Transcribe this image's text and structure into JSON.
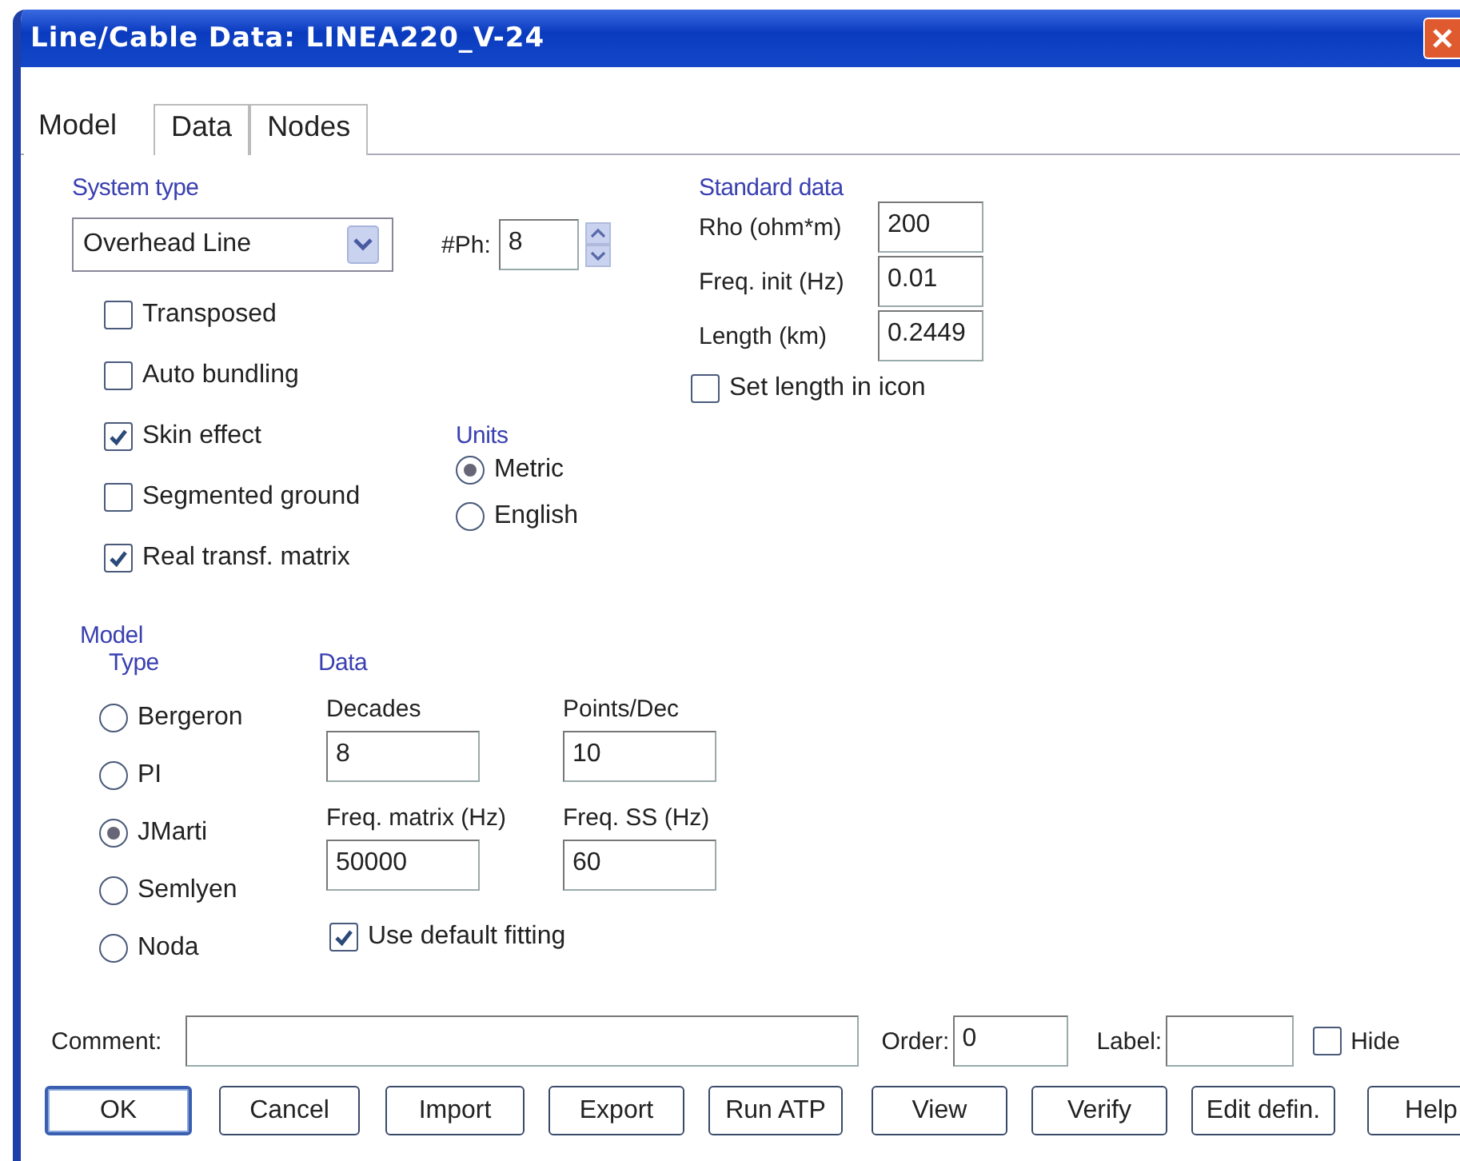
{
  "window": {
    "title": "Line/Cable Data: LINEA220_V-24"
  },
  "tabs": [
    {
      "label": "Model",
      "selected": true
    },
    {
      "label": "Data",
      "selected": false
    },
    {
      "label": "Nodes",
      "selected": false
    }
  ],
  "system_type": {
    "heading": "System type",
    "value": "Overhead Line",
    "phases_label": "#Ph:",
    "phases": "8"
  },
  "options": [
    {
      "label": "Transposed",
      "checked": false
    },
    {
      "label": "Auto bundling",
      "checked": false
    },
    {
      "label": "Skin effect",
      "checked": true
    },
    {
      "label": "Segmented ground",
      "checked": false
    },
    {
      "label": "Real transf. matrix",
      "checked": true
    }
  ],
  "units": {
    "heading": "Units",
    "options": [
      {
        "label": "Metric",
        "selected": true
      },
      {
        "label": "English",
        "selected": false
      }
    ]
  },
  "standard_data": {
    "heading": "Standard data",
    "fields": [
      {
        "label": "Rho (ohm*m)",
        "value": "200"
      },
      {
        "label": "Freq. init (Hz)",
        "value": "0.01"
      },
      {
        "label": "Length (km)",
        "value": "0.2449"
      }
    ],
    "set_length": {
      "label": "Set length in icon",
      "checked": false
    }
  },
  "model": {
    "heading": "Model",
    "type_heading": "Type",
    "types": [
      {
        "label": "Bergeron",
        "selected": false
      },
      {
        "label": "PI",
        "selected": false
      },
      {
        "label": "JMarti",
        "selected": true
      },
      {
        "label": "Semlyen",
        "selected": false
      },
      {
        "label": "Noda",
        "selected": false
      }
    ],
    "data_heading": "Data",
    "fields": [
      {
        "label": "Decades",
        "value": "8"
      },
      {
        "label": "Points/Dec",
        "value": "10"
      },
      {
        "label": "Freq. matrix (Hz)",
        "value": "50000"
      },
      {
        "label": "Freq. SS (Hz)",
        "value": "60"
      }
    ],
    "default_fitting": {
      "label": "Use default fitting",
      "checked": true
    }
  },
  "footer": {
    "comment_label": "Comment:",
    "order_label": "Order:",
    "order": "0",
    "label_label": "Label:",
    "hide": {
      "label": "Hide",
      "checked": false
    }
  },
  "buttons": [
    "OK",
    "Cancel",
    "Import",
    "Export",
    "Run ATP",
    "View",
    "Verify",
    "Edit defin.",
    "Help"
  ]
}
